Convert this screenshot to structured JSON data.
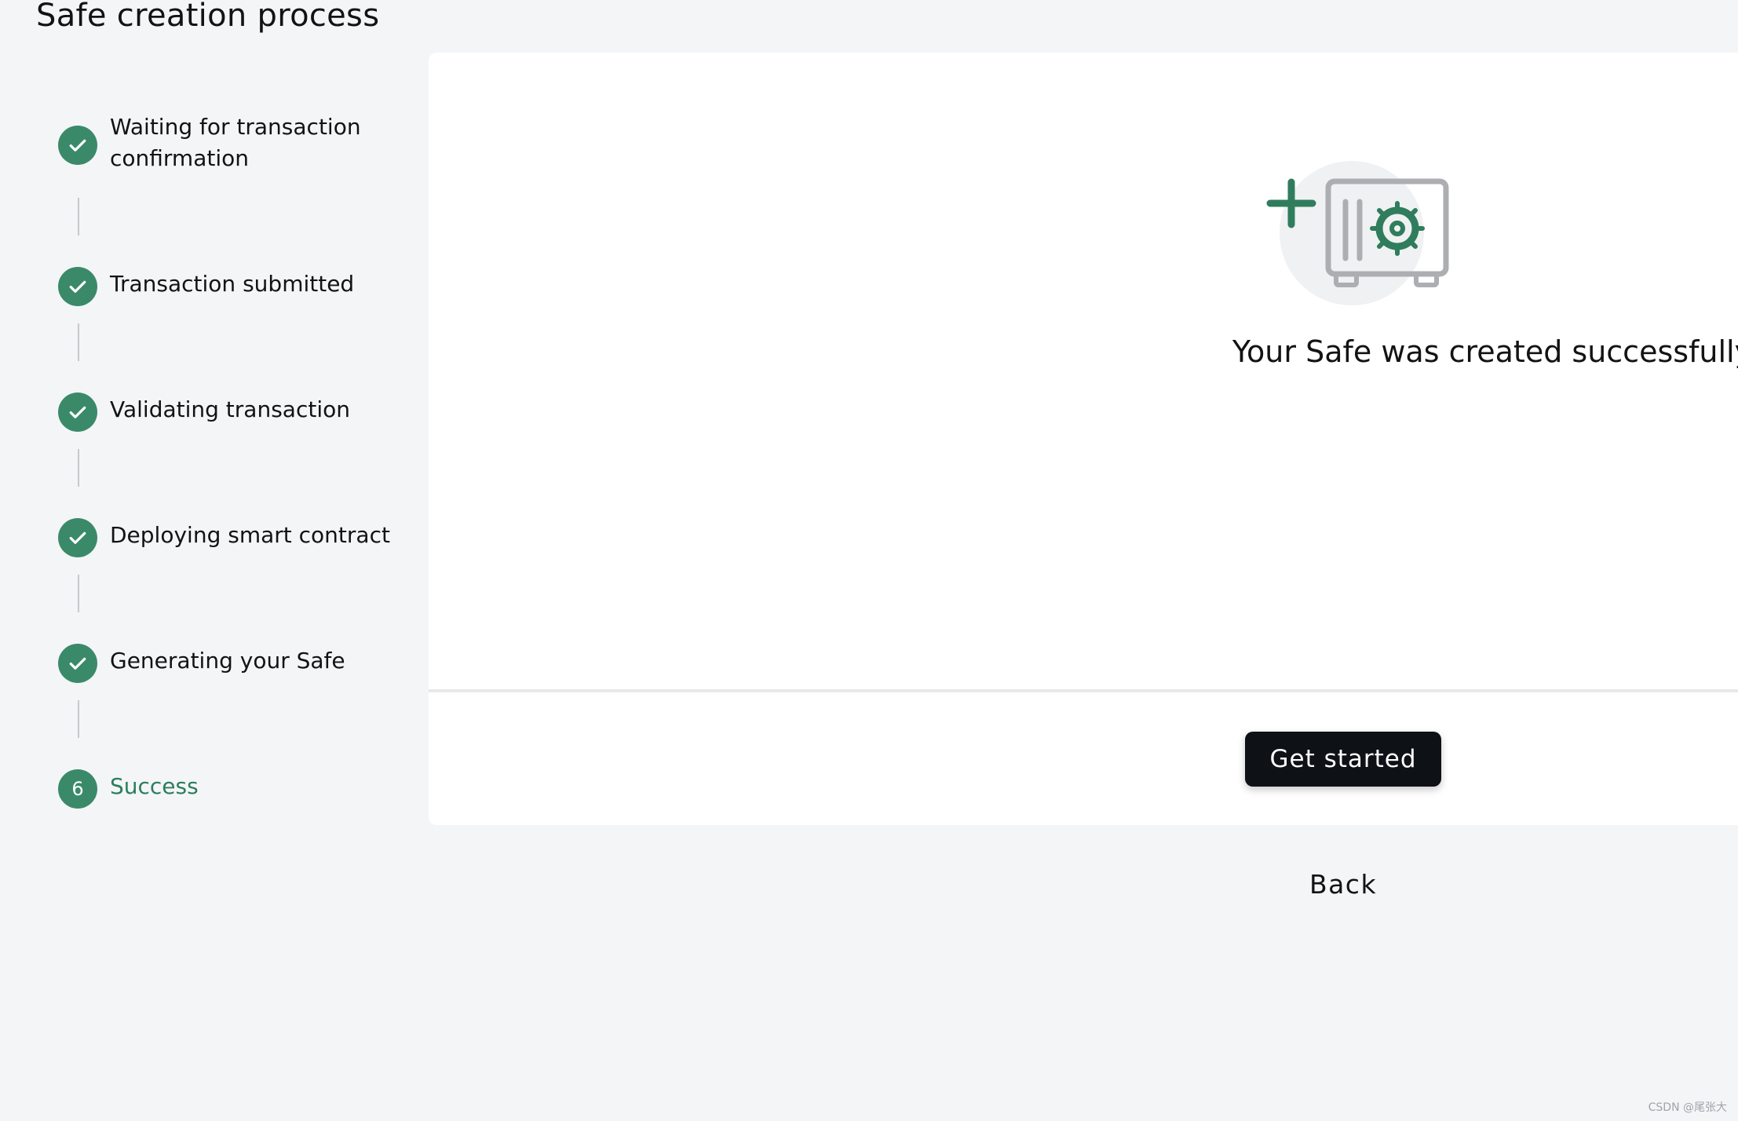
{
  "page": {
    "title": "Safe creation process"
  },
  "colors": {
    "accent": "#3a8a6a",
    "active_text": "#2c7e5c",
    "background": "#f4f5f7",
    "card": "#ffffff",
    "button": "#0e1116"
  },
  "steps": [
    {
      "label": "Waiting for transaction confirmation",
      "state": "completed",
      "icon": "check-icon"
    },
    {
      "label": "Transaction submitted",
      "state": "completed",
      "icon": "check-icon"
    },
    {
      "label": "Validating transaction",
      "state": "completed",
      "icon": "check-icon"
    },
    {
      "label": "Deploying smart contract",
      "state": "completed",
      "icon": "check-icon"
    },
    {
      "label": "Generating your Safe",
      "state": "completed",
      "icon": "check-icon"
    },
    {
      "label": "Success",
      "state": "active",
      "number": "6"
    }
  ],
  "result": {
    "icon": "safe-created-icon",
    "message": "Your Safe was created successfully"
  },
  "actions": {
    "get_started_label": "Get started",
    "back_label": "Back"
  },
  "watermark": "CSDN @尾张大"
}
